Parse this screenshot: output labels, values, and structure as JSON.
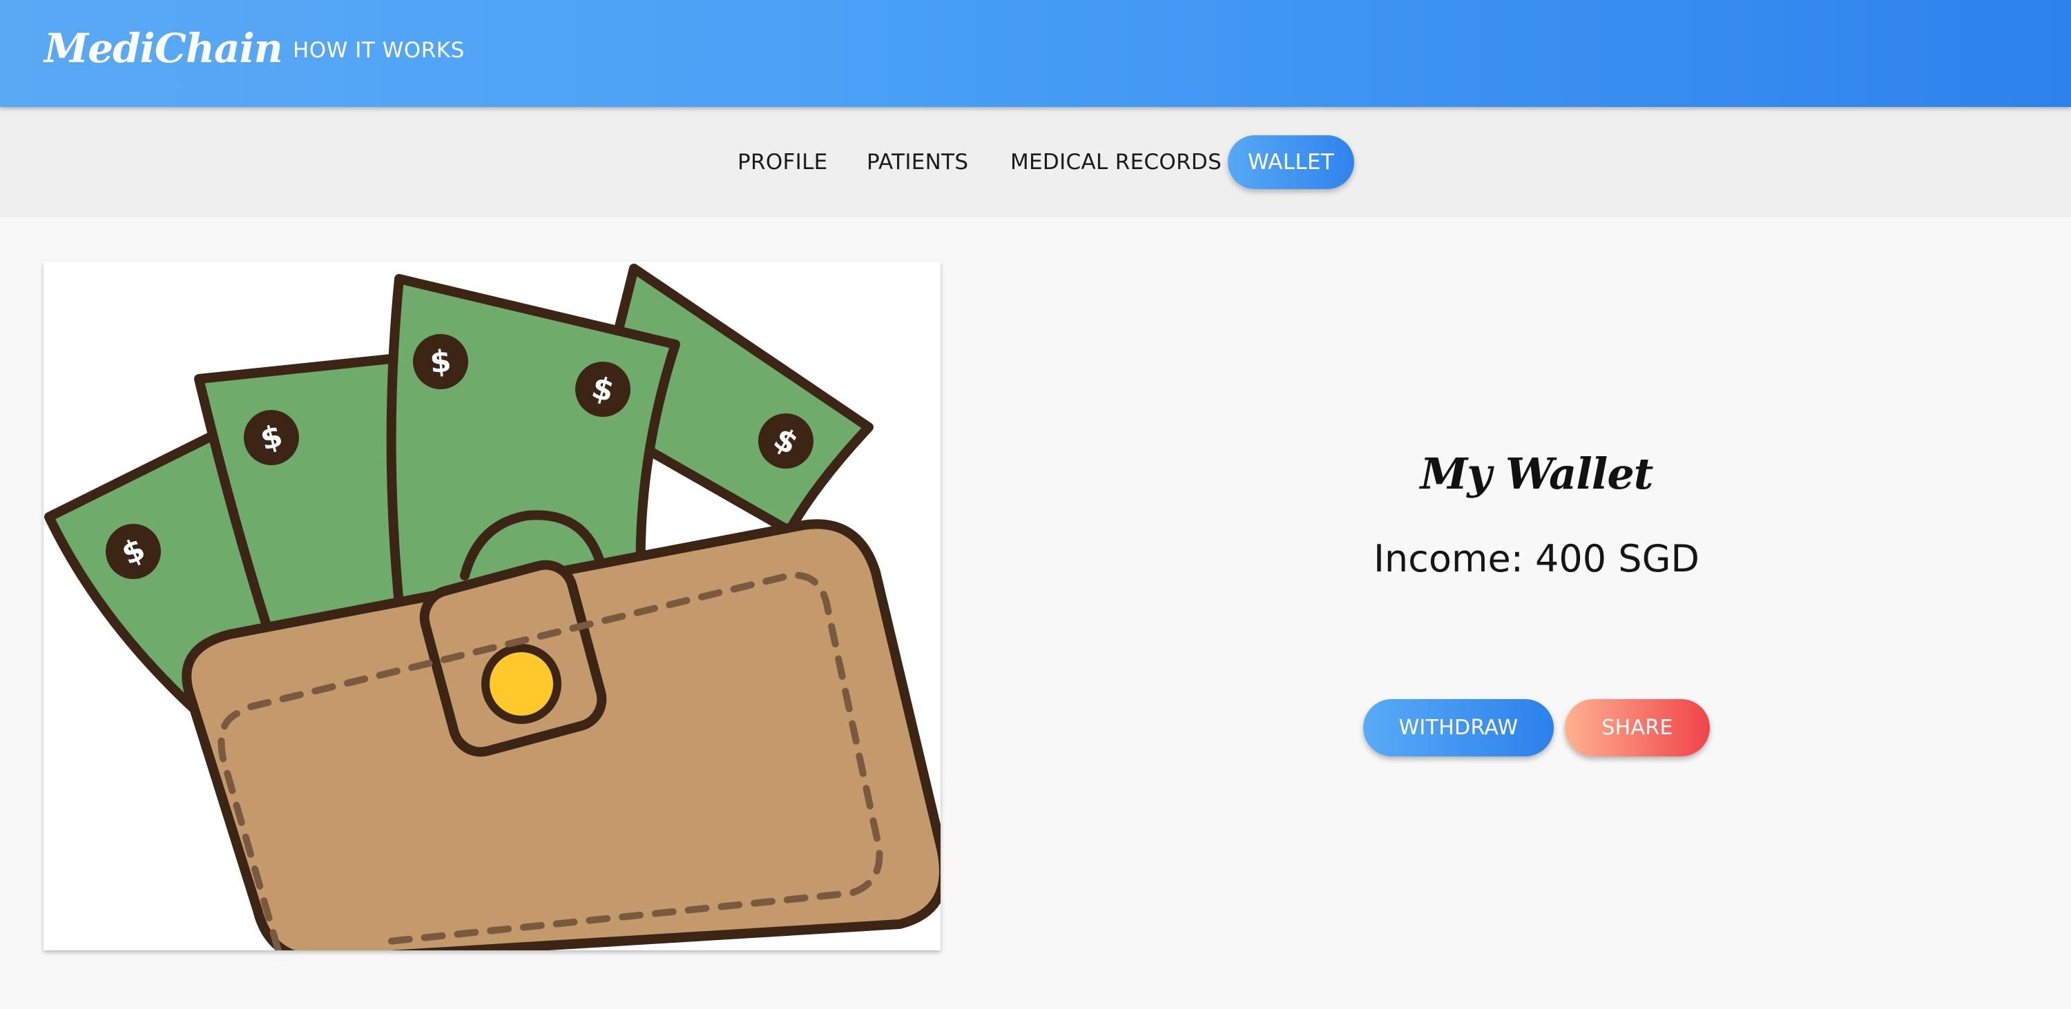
{
  "header": {
    "brand": "MediChain",
    "nav_link": "HOW IT WORKS"
  },
  "tabs": [
    {
      "label": "PROFILE"
    },
    {
      "label": "PATIENTS"
    },
    {
      "label": "MEDICAL RECORDS"
    },
    {
      "label": "WALLET",
      "active": true
    }
  ],
  "main": {
    "title": "My Wallet",
    "income": "Income: 400 SGD",
    "withdraw_label": "WITHDRAW",
    "share_label": "SHARE"
  },
  "colors": {
    "header_gradient_start": "#5aa9f5",
    "header_gradient_end": "#2e82ed",
    "withdraw_gradient": [
      "#58abf6",
      "#2c80ec"
    ],
    "share_gradient": [
      "#ffb190",
      "#f0444a"
    ],
    "money_green": "#6fab6a",
    "wallet_brown": "#c4996b",
    "outline": "#3d2516",
    "clasp_gold": "#ffc92b"
  },
  "icons": {
    "illustration": "wallet-with-cash-icon"
  }
}
